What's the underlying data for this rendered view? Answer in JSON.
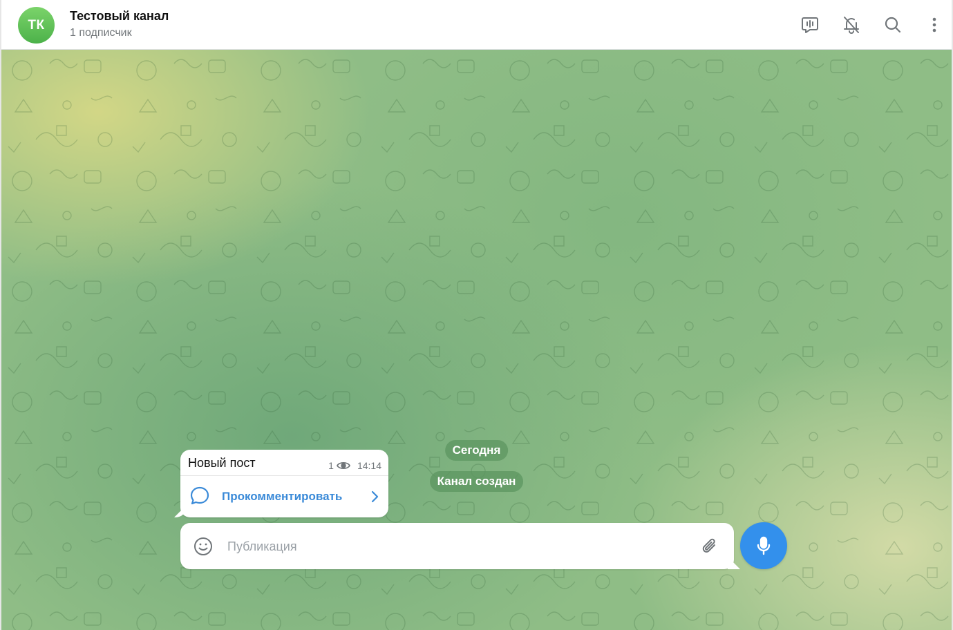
{
  "header": {
    "avatar_initials": "ТК",
    "title": "Тестовый канал",
    "subtitle": "1 подписчик",
    "actions": [
      {
        "name": "live-stream-icon"
      },
      {
        "name": "mute-bell-icon"
      },
      {
        "name": "search-icon"
      },
      {
        "name": "more-vertical-icon"
      }
    ]
  },
  "chat": {
    "date_pill": "Сегодня",
    "service_message": "Канал создан",
    "message": {
      "text": "Новый пост",
      "views": "1",
      "time": "14:14",
      "comment_label": "Прокомментировать"
    }
  },
  "composer": {
    "placeholder": "Публикация"
  },
  "colors": {
    "accent": "#3390ec",
    "comment_text": "#3a8ad8",
    "avatar": "#5cbf56",
    "service_pill": "#5c9660"
  }
}
